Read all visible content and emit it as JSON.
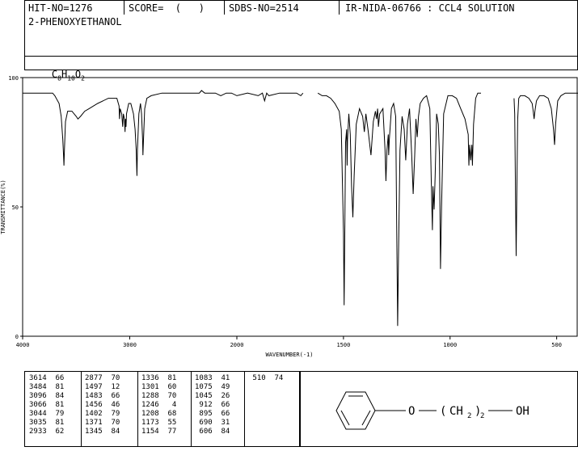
{
  "header": {
    "hit_no": "HIT-NO=1276",
    "score": "SCORE=  (   )",
    "sdbs_no": "SDBS-NO=2514",
    "ir_nida": "IR-NIDA-06766 : CCL4 SOLUTION"
  },
  "compound": {
    "name": "2-PHENOXYETHANOL",
    "formula_c": "C",
    "formula_c_sub": "8",
    "formula_h": "H",
    "formula_h_sub": "10",
    "formula_o": "O",
    "formula_o_sub": "2"
  },
  "structure": {
    "oxygen": "O",
    "open_paren": "(",
    "ch2": "CH",
    "ch2_sub": "2",
    "close_paren": ")",
    "repeat": "2",
    "oh": "OH"
  },
  "peak_table": [
    [
      "3614  66",
      "3484  81",
      "3096  84",
      "3066  81",
      "3044  79",
      "3035  81",
      "2933  62"
    ],
    [
      "2877  70",
      "1497  12",
      "1483  66",
      "1456  46",
      "1402  79",
      "1371  70",
      "1345  84"
    ],
    [
      "1336  81",
      "1301  60",
      "1288  70",
      "1246   4",
      "1208  68",
      "1173  55",
      "1154  77"
    ],
    [
      "1083  41",
      "1075  49",
      "1045  26",
      " 912  66",
      " 895  66",
      " 690  31",
      " 606  84"
    ],
    [
      " 510  74"
    ]
  ],
  "chart_data": {
    "type": "line",
    "xlabel": "WAVENUMBER(-1)",
    "ylabel": "TRANSMITTANCE(%)",
    "xlim": [
      4000,
      400
    ],
    "ylim": [
      0,
      100
    ],
    "xticks": [
      "4000",
      "3000",
      "2000",
      "1500",
      "1000",
      "500"
    ],
    "yticks": [
      "0",
      "50",
      "100"
    ],
    "grid": false,
    "series": [
      {
        "x": [
          4000,
          3800,
          3720,
          3700,
          3660,
          3640,
          3625,
          3618,
          3614,
          3610,
          3600,
          3580,
          3540,
          3500,
          3484,
          3460,
          3420,
          3380,
          3300,
          3200,
          3120,
          3100,
          3096,
          3090,
          3075,
          3066,
          3060,
          3050,
          3044,
          3040,
          3035,
          3030,
          3010,
          2990,
          2965,
          2950,
          2940,
          2933,
          2928,
          2915,
          2900,
          2890,
          2880,
          2877,
          2872,
          2860,
          2840,
          2800,
          2700,
          2600,
          2500,
          2400,
          2350,
          2330,
          2300,
          2200,
          2150,
          2100,
          2050,
          2000,
          1950,
          1900,
          1880,
          1870,
          1860,
          1850,
          1800,
          1750,
          1720,
          1700,
          1690
        ],
        "y": [
          94,
          94,
          94,
          93,
          90,
          85,
          76,
          70,
          66,
          72,
          83,
          87,
          87,
          85,
          84,
          85,
          87,
          88,
          90,
          92,
          92,
          89,
          84,
          88,
          86,
          81,
          86,
          84,
          79,
          84,
          81,
          86,
          90,
          90,
          86,
          80,
          72,
          62,
          72,
          86,
          90,
          86,
          76,
          70,
          76,
          88,
          92,
          93,
          94,
          94,
          94,
          94,
          94,
          95,
          94,
          94,
          93,
          94,
          94,
          93,
          94,
          93,
          94,
          91,
          94,
          93,
          94,
          94,
          94,
          93,
          94
        ]
      },
      {
        "x": [
          1620,
          1600,
          1580,
          1560,
          1540,
          1520,
          1510,
          1500,
          1497,
          1494,
          1490,
          1485,
          1483,
          1481,
          1475,
          1468,
          1462,
          1456,
          1450,
          1440,
          1425,
          1410,
          1402,
          1395,
          1385,
          1371,
          1360,
          1350,
          1345,
          1340,
          1336,
          1330,
          1315,
          1305,
          1301,
          1296,
          1290,
          1288,
          1285,
          1275,
          1265,
          1255,
          1250,
          1246,
          1242,
          1235,
          1225,
          1215,
          1208,
          1200,
          1190,
          1180,
          1173,
          1166,
          1160,
          1154,
          1148,
          1140,
          1125,
          1110,
          1095,
          1088,
          1083,
          1080,
          1075,
          1070,
          1063,
          1055,
          1050,
          1045,
          1040,
          1030,
          1010,
          990,
          970,
          950,
          930,
          915,
          912,
          908,
          903,
          898,
          895,
          890,
          880,
          870,
          860,
          855
        ],
        "y": [
          94,
          93,
          93,
          92,
          90,
          87,
          80,
          40,
          12,
          40,
          75,
          80,
          66,
          76,
          86,
          78,
          58,
          46,
          62,
          82,
          88,
          85,
          79,
          86,
          80,
          70,
          83,
          87,
          84,
          88,
          81,
          86,
          88,
          72,
          60,
          72,
          78,
          70,
          76,
          88,
          90,
          85,
          40,
          4,
          30,
          72,
          85,
          80,
          68,
          82,
          88,
          70,
          55,
          70,
          84,
          77,
          85,
          90,
          92,
          93,
          88,
          60,
          41,
          58,
          49,
          62,
          86,
          82,
          70,
          26,
          50,
          86,
          93,
          93,
          92,
          88,
          84,
          78,
          66,
          74,
          68,
          74,
          66,
          82,
          92,
          94,
          94,
          94
        ]
      },
      {
        "x": [
          700,
          697,
          693,
          690,
          687,
          683,
          678,
          670,
          650,
          630,
          615,
          610,
          606,
          602,
          595,
          580,
          560,
          540,
          525,
          515,
          510,
          505,
          495,
          480,
          460,
          440,
          420,
          400
        ],
        "y": [
          92,
          86,
          55,
          31,
          55,
          84,
          92,
          93,
          93,
          92,
          90,
          87,
          84,
          87,
          91,
          93,
          93,
          92,
          88,
          80,
          74,
          82,
          91,
          93,
          94,
          94,
          94,
          94
        ]
      }
    ]
  }
}
